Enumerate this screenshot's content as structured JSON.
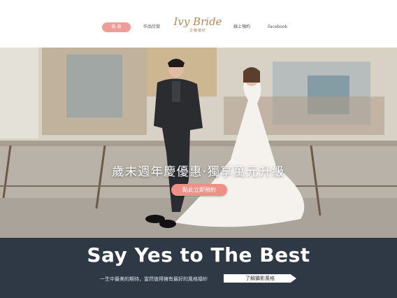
{
  "nav": {
    "home_label": "首 頁",
    "works_label": "作品欣賞",
    "booking_label": "線上預約",
    "facebook_label": "Facebook"
  },
  "logo": {
    "script_text": "Ivy Bride",
    "sub_text": "艾薇婚紗"
  },
  "hero": {
    "promo_text": "歲末週年慶優惠·獨享萬元升級",
    "cta_label": "點此立即預約"
  },
  "banner": {
    "headline": "Say Yes to The Best",
    "tagline": "一生中最美的期待，當然值得擁有最好的風格婚紗",
    "cta_label": "了解攝影風格"
  },
  "colors": {
    "accent_pink": "#ef9d98",
    "band_navy": "#2e3945",
    "logo_gold": "#b08a5a"
  }
}
